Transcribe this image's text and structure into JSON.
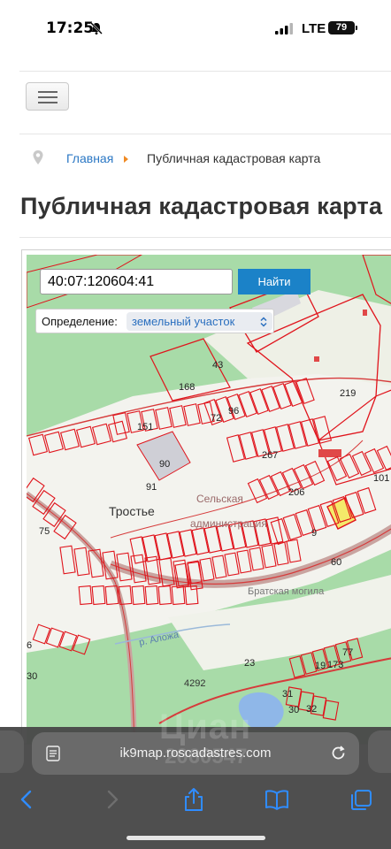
{
  "status_bar": {
    "time": "17:25",
    "network": "LTE",
    "battery": "79",
    "icons": [
      "bell-slash-icon",
      "cellular-signal-icon",
      "battery-icon"
    ]
  },
  "breadcrumb": {
    "home": "Главная",
    "current": "Публичная кадастровая карта"
  },
  "page": {
    "title": "Публичная кадастровая карта"
  },
  "map": {
    "search_value": "40:07:120604:41",
    "find_label": "Найти",
    "definition_label": "Определение:",
    "definition_value": "земельный участок",
    "labels": {
      "village": "Тростье",
      "admin_line1": "Сельская",
      "admin_line2": "администрация",
      "memorial": "Братская могила",
      "river": "р. Аложа",
      "road": "4292",
      "parcels": [
        "43",
        "168",
        "219",
        "72",
        "96",
        "151",
        "267",
        "90",
        "91",
        "206",
        "101",
        "75",
        "60",
        "9",
        "23",
        "19",
        "173",
        "77",
        "31",
        "30",
        "32",
        "6",
        "30"
      ]
    },
    "colors": {
      "forest": "#a8dba8",
      "open_land": "#f3f3ee",
      "parcel_line": "#e0141c",
      "road": "#c8a5a0",
      "water": "#8fb7e8",
      "building": "#cfcfd6",
      "selected_parcel": "#f4ea6a"
    }
  },
  "browser": {
    "url": "ik9map.roscadastres.com",
    "watermark": "Циан",
    "watermark_number": "2060547",
    "icons": [
      "back-icon",
      "forward-icon",
      "share-icon",
      "bookmarks-icon",
      "tabs-icon"
    ]
  }
}
